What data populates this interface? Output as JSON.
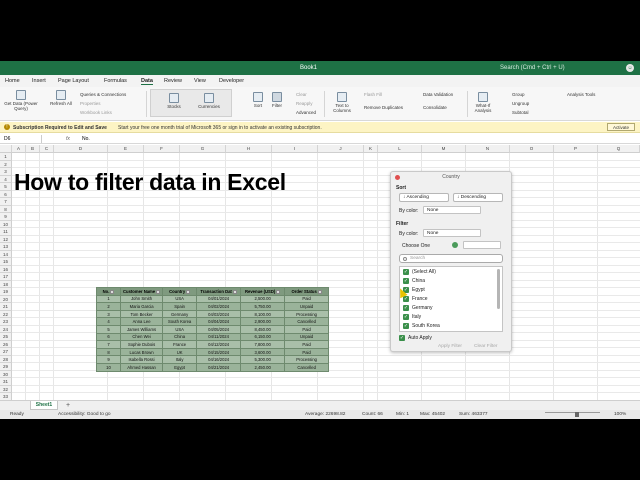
{
  "window": {
    "title": "Book1",
    "search": "Search (Cmd + Ctrl + U)"
  },
  "menu": [
    "Home",
    "Insert",
    "Page Layout",
    "Formulas",
    "Data",
    "Review",
    "View",
    "Developer"
  ],
  "menu_active": "Data",
  "ribbon": {
    "get_data": "Get Data (Power Query)",
    "refresh_all": "Refresh All",
    "queries": "Queries & Connections",
    "properties": "Properties",
    "workbook_links": "Workbook Links",
    "stocks": "Stocks",
    "currencies": "Currencies",
    "sort": "Sort",
    "filter": "Filter",
    "clear": "Clear",
    "reapply": "Reapply",
    "advanced": "Advanced",
    "text_to_columns": "Text to Columns",
    "flash_fill": "Flash Fill",
    "remove_duplicates": "Remove Duplicates",
    "data_validation": "Data Validation",
    "consolidate": "Consolidate",
    "what_if": "What-If Analysis",
    "group": "Group",
    "ungroup": "Ungroup",
    "subtotal": "Subtotal",
    "analysis_tools": "Analysis Tools"
  },
  "message": {
    "bold": "Subscription Required to Edit and Save",
    "text": "Start your free one month trial of Microsoft 365 or sign in to activate an existing subscription.",
    "button": "Activate"
  },
  "formula_bar": {
    "name_box": "D6",
    "fx": "fx",
    "value": "No."
  },
  "columns": [
    "A",
    "B",
    "C",
    "D",
    "E",
    "F",
    "G",
    "H",
    "I",
    "J",
    "K",
    "L",
    "M",
    "N",
    "O",
    "P",
    "Q",
    "R"
  ],
  "rows": [
    "1",
    "2",
    "3",
    "4",
    "5",
    "6",
    "7",
    "8",
    "9",
    "10",
    "11",
    "12",
    "13",
    "14",
    "15",
    "16",
    "17",
    "18",
    "19",
    "20",
    "21",
    "22",
    "23",
    "24",
    "25",
    "26",
    "27",
    "28",
    "29",
    "30",
    "31",
    "32",
    "33"
  ],
  "sheet_title": "How to filter data in Excel",
  "table": {
    "headers": [
      "No.",
      "Customer Name",
      "Country",
      "Transaction Dat",
      "Revenue (USD)",
      "Order Status"
    ],
    "rows": [
      [
        "1",
        "John Smith",
        "USA",
        "04/01/2024",
        "2,500.00",
        "Paid"
      ],
      [
        "2",
        "Maria Garcia",
        "Spain",
        "04/02/2024",
        "5,750.00",
        "Unpaid"
      ],
      [
        "3",
        "Tom Becker",
        "Germany",
        "04/03/2024",
        "8,100.00",
        "Processing"
      ],
      [
        "4",
        "Anna Lee",
        "South Korea",
        "04/04/2024",
        "2,900.00",
        "Cancelled"
      ],
      [
        "5",
        "James Williams",
        "USA",
        "04/05/2024",
        "8,450.00",
        "Paid"
      ],
      [
        "6",
        "Chen Wei",
        "China",
        "04/11/2024",
        "6,150.00",
        "Unpaid"
      ],
      [
        "7",
        "Sophie Dubois",
        "France",
        "04/12/2024",
        "7,800.00",
        "Paid"
      ],
      [
        "8",
        "Lucas Brown",
        "UK",
        "04/15/2024",
        "3,600.00",
        "Paid"
      ],
      [
        "9",
        "Isabella Rossi",
        "Italy",
        "04/16/2024",
        "5,300.00",
        "Processing"
      ],
      [
        "10",
        "Ahmed Hassan",
        "Egypt",
        "04/21/2024",
        "2,450.00",
        "Cancelled"
      ]
    ]
  },
  "filter_panel": {
    "title": "Country",
    "sort_label": "Sort",
    "ascending": "Ascending",
    "descending": "Descending",
    "by_color_label": "By color:",
    "by_color_value": "None",
    "filter_label": "Filter",
    "filter_by_color_label": "By color:",
    "filter_by_color_value": "None",
    "choose_one": "Choose One",
    "search_placeholder": "Search",
    "items": [
      "(Select All)",
      "China",
      "Egypt",
      "France",
      "Germany",
      "Italy",
      "South Korea"
    ],
    "auto_apply": "Auto Apply",
    "apply_filter": "Apply Filter",
    "clear_filter": "Clear Filter"
  },
  "sheets": [
    "Sheet1"
  ],
  "add_sheet": "+",
  "status": {
    "ready": "Ready",
    "accessibility": "Accessibility: Good to go",
    "average": "Average: 22698.82",
    "count": "Count: 66",
    "min": "Min: 1",
    "max": "Max: 45402",
    "sum": "Sum: 463377",
    "zoom": "100%"
  },
  "colors": {
    "brand": "#1e7145",
    "table_header": "#7f9a7f",
    "table_row": "#a9bfa9",
    "checkbox": "#3a8f4a"
  }
}
